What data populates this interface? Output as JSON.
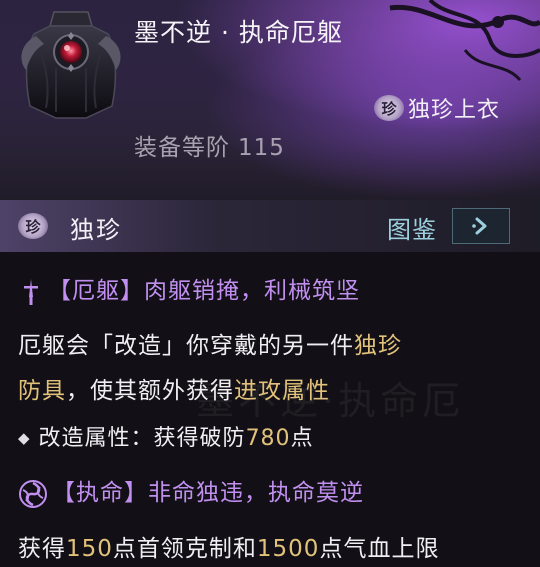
{
  "item": {
    "name": "墨不逆 · 执命厄躯",
    "type_glyph": "珍",
    "type_label": "独珍上衣",
    "rank_label": "装备等阶",
    "rank_value": "115"
  },
  "quality": {
    "glyph": "珍",
    "label": "独珍",
    "codex_label": "图鉴"
  },
  "effects": [
    {
      "title": "【厄躯】肉躯销掩，利械筑坚",
      "desc_a": "厄躯会「改造」你穿戴的另一件",
      "desc_b": "独珍",
      "desc_c": "防具",
      "desc_d": "，使其额外获得",
      "desc_e": "进攻属性",
      "bullet_label": "改造属性：获得破防",
      "bullet_value": "780",
      "bullet_unit": "点"
    },
    {
      "title": "【执命】非命独违，执命莫逆",
      "desc_a": "获得",
      "desc_b": "150",
      "desc_c": "点首领克制和",
      "desc_d": "1500",
      "desc_e": "点气血上限"
    }
  ],
  "colors": {
    "accent_purple": "#c08ff0",
    "value_gold": "#e2c27a",
    "codex_cyan": "#9dd0df"
  }
}
